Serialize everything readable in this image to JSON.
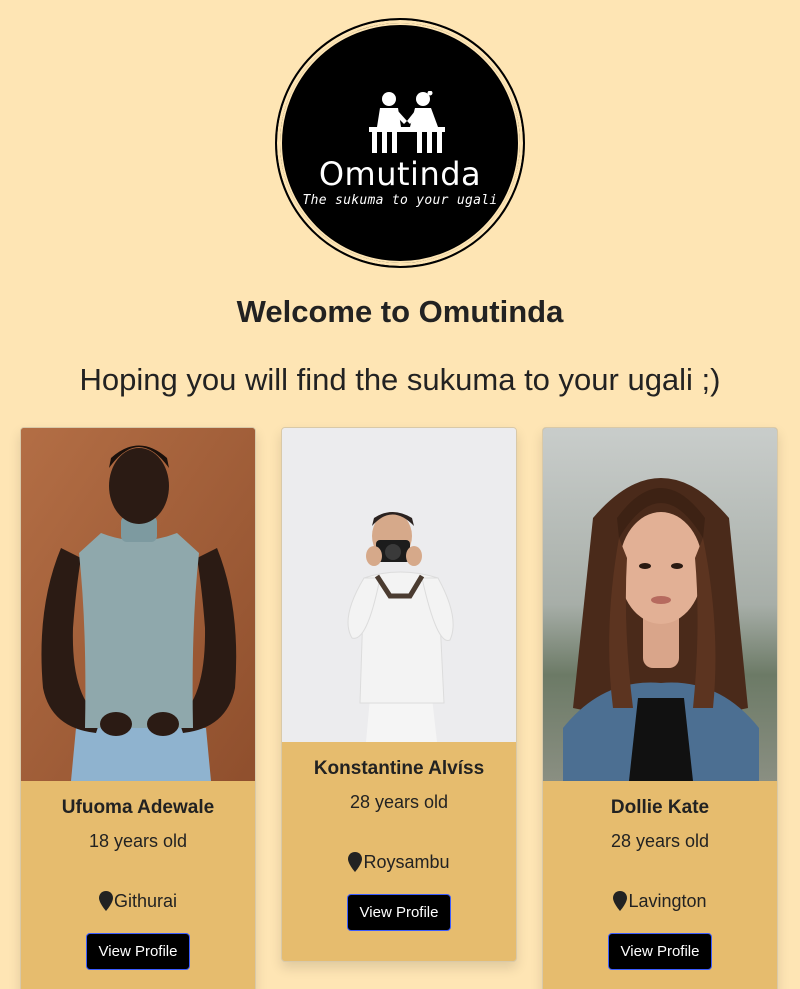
{
  "logo": {
    "name": "Omutinda",
    "tagline": "The sukuma to your ugali"
  },
  "header": {
    "welcome": "Welcome to Omutinda",
    "subtitle": "Hoping you will find the sukuma to your ugali ;)"
  },
  "profiles": [
    {
      "name": "Ufuoma Adewale",
      "age": "18 years old",
      "location": "Githurai",
      "button": "View Profile"
    },
    {
      "name": "Konstantine Alvíss",
      "age": "28 years old",
      "location": "Roysambu",
      "button": "View Profile"
    },
    {
      "name": "Dollie Kate",
      "age": "28 years old",
      "location": "Lavington",
      "button": "View Profile"
    }
  ],
  "colors": {
    "page_background": "#fee5b4",
    "card_background": "#e6bc6e",
    "button_background": "#000000",
    "button_border": "#3b5cff"
  },
  "icons": {
    "location": "map-pin-icon"
  }
}
